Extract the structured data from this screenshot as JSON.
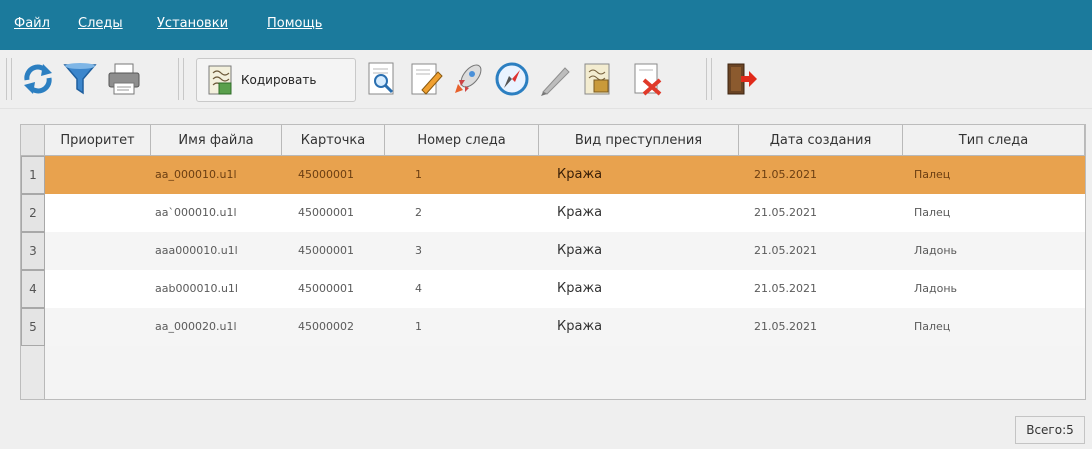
{
  "menu": {
    "items": [
      {
        "label": "Файл"
      },
      {
        "label": "Следы"
      },
      {
        "label": "Установки"
      },
      {
        "label": "Помощь"
      }
    ]
  },
  "toolbar": {
    "encode_label": "Кодировать",
    "icons": [
      "refresh-icon",
      "filter-icon",
      "print-icon",
      "encode-icon",
      "search-doc-icon",
      "edit-doc-icon",
      "launch-icon",
      "compass-icon",
      "pen-tool-icon",
      "image-edit-icon",
      "delete-doc-icon",
      "exit-icon"
    ]
  },
  "table": {
    "columns": [
      "Приоритет",
      "Имя файла",
      "Карточка",
      "Номер следа",
      "Вид преступления",
      "Дата создания",
      "Тип следа"
    ],
    "rows": [
      {
        "num": "1",
        "priority": "",
        "file": "aa_000010.u1l",
        "card": "45000001",
        "trace_no": "1",
        "crime": "Кража",
        "date": "21.05.2021",
        "trace_type": "Палец"
      },
      {
        "num": "2",
        "priority": "",
        "file": "aa`000010.u1l",
        "card": "45000001",
        "trace_no": "2",
        "crime": "Кража",
        "date": "21.05.2021",
        "trace_type": "Палец"
      },
      {
        "num": "3",
        "priority": "",
        "file": "aaa000010.u1l",
        "card": "45000001",
        "trace_no": "3",
        "crime": "Кража",
        "date": "21.05.2021",
        "trace_type": "Ладонь"
      },
      {
        "num": "4",
        "priority": "",
        "file": "aab000010.u1l",
        "card": "45000001",
        "trace_no": "4",
        "crime": "Кража",
        "date": "21.05.2021",
        "trace_type": "Ладонь"
      },
      {
        "num": "5",
        "priority": "",
        "file": "aa_000020.u1l",
        "card": "45000002",
        "trace_no": "1",
        "crime": "Кража",
        "date": "21.05.2021",
        "trace_type": "Палец"
      }
    ],
    "selected_row": 1
  },
  "status": {
    "total": "Всего:5"
  },
  "colors": {
    "menubar": "#1b7a9c",
    "selection": "#e8a24e"
  }
}
